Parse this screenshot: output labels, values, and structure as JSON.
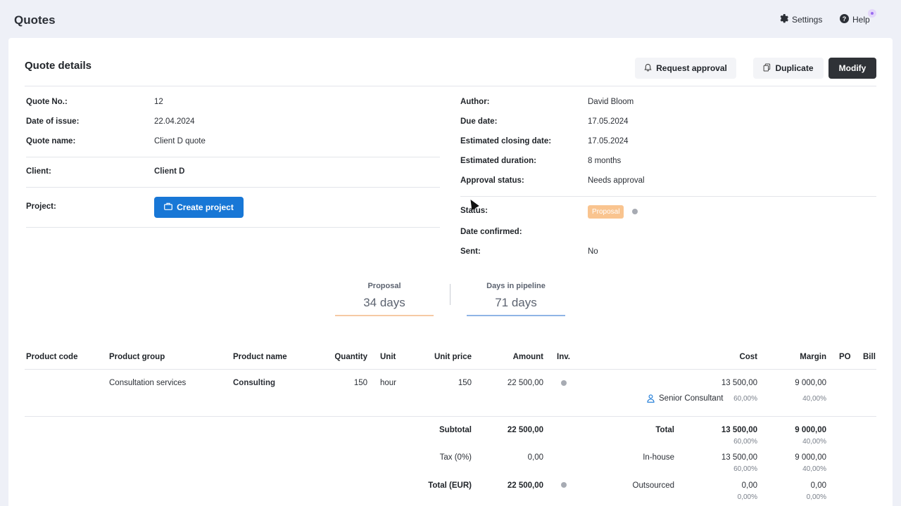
{
  "app": {
    "title": "Quotes"
  },
  "topbar": {
    "settings_label": "Settings",
    "help_label": "Help"
  },
  "page": {
    "title": "Quote details"
  },
  "actions": {
    "request_approval": "Request approval",
    "duplicate": "Duplicate",
    "modify": "Modify"
  },
  "left": {
    "quote_no_label": "Quote No.:",
    "quote_no": "12",
    "date_issue_label": "Date of issue:",
    "date_issue": "22.04.2024",
    "quote_name_label": "Quote name:",
    "quote_name": "Client D quote",
    "client_label": "Client:",
    "client": "Client D",
    "project_label": "Project:",
    "create_project": "Create project"
  },
  "right": {
    "author_label": "Author:",
    "author": "David Bloom",
    "due_label": "Due date:",
    "due": "17.05.2024",
    "closing_label": "Estimated closing date:",
    "closing": "17.05.2024",
    "duration_label": "Estimated duration:",
    "duration": "8 months",
    "approval_label": "Approval status:",
    "approval": "Needs approval",
    "status_label": "Status:",
    "status": "Proposal",
    "confirmed_label": "Date confirmed:",
    "sent_label": "Sent:",
    "sent": "No"
  },
  "stats": {
    "proposal_label": "Proposal",
    "proposal_value": "34 days",
    "pipeline_label": "Days in pipeline",
    "pipeline_value": "71 days"
  },
  "table": {
    "headers": {
      "product_code": "Product code",
      "product_group": "Product group",
      "product_name": "Product name",
      "quantity": "Quantity",
      "unit": "Unit",
      "unit_price": "Unit price",
      "amount": "Amount",
      "inv": "Inv.",
      "cost": "Cost",
      "margin": "Margin",
      "po": "PO",
      "bill": "Bill"
    },
    "row": {
      "product_group": "Consultation services",
      "product_name": "Consulting",
      "quantity": "150",
      "unit": "hour",
      "unit_price": "150",
      "amount": "22 500,00",
      "cost": "13 500,00",
      "margin": "9 000,00",
      "resource": "Senior Consultant",
      "cost_pct": "60,00%",
      "margin_pct": "40,00%"
    }
  },
  "totals": {
    "subtotal_label": "Subtotal",
    "subtotal": "22 500,00",
    "tax_label": "Tax (0%)",
    "tax": "0,00",
    "total_label": "Total (EUR)",
    "total": "22 500,00",
    "total_cost_label": "Total",
    "total_cost": "13 500,00",
    "total_cost_pct": "60,00%",
    "total_margin": "9 000,00",
    "total_margin_pct": "40,00%",
    "inhouse_label": "In-house",
    "inhouse_cost": "13 500,00",
    "inhouse_cost_pct": "60,00%",
    "inhouse_margin": "9 000,00",
    "inhouse_margin_pct": "40,00%",
    "outsourced_label": "Outsourced",
    "outsourced_cost": "0,00",
    "outsourced_cost_pct": "0,00%",
    "outsourced_margin": "0,00",
    "outsourced_margin_pct": "0,00%"
  },
  "colors": {
    "primary": "#1877d6",
    "dark_button": "#2f3237",
    "proposal_badge": "#f9c48f",
    "proposal_line": "#f6c9a4",
    "pipeline_line": "#8fb5e6"
  }
}
